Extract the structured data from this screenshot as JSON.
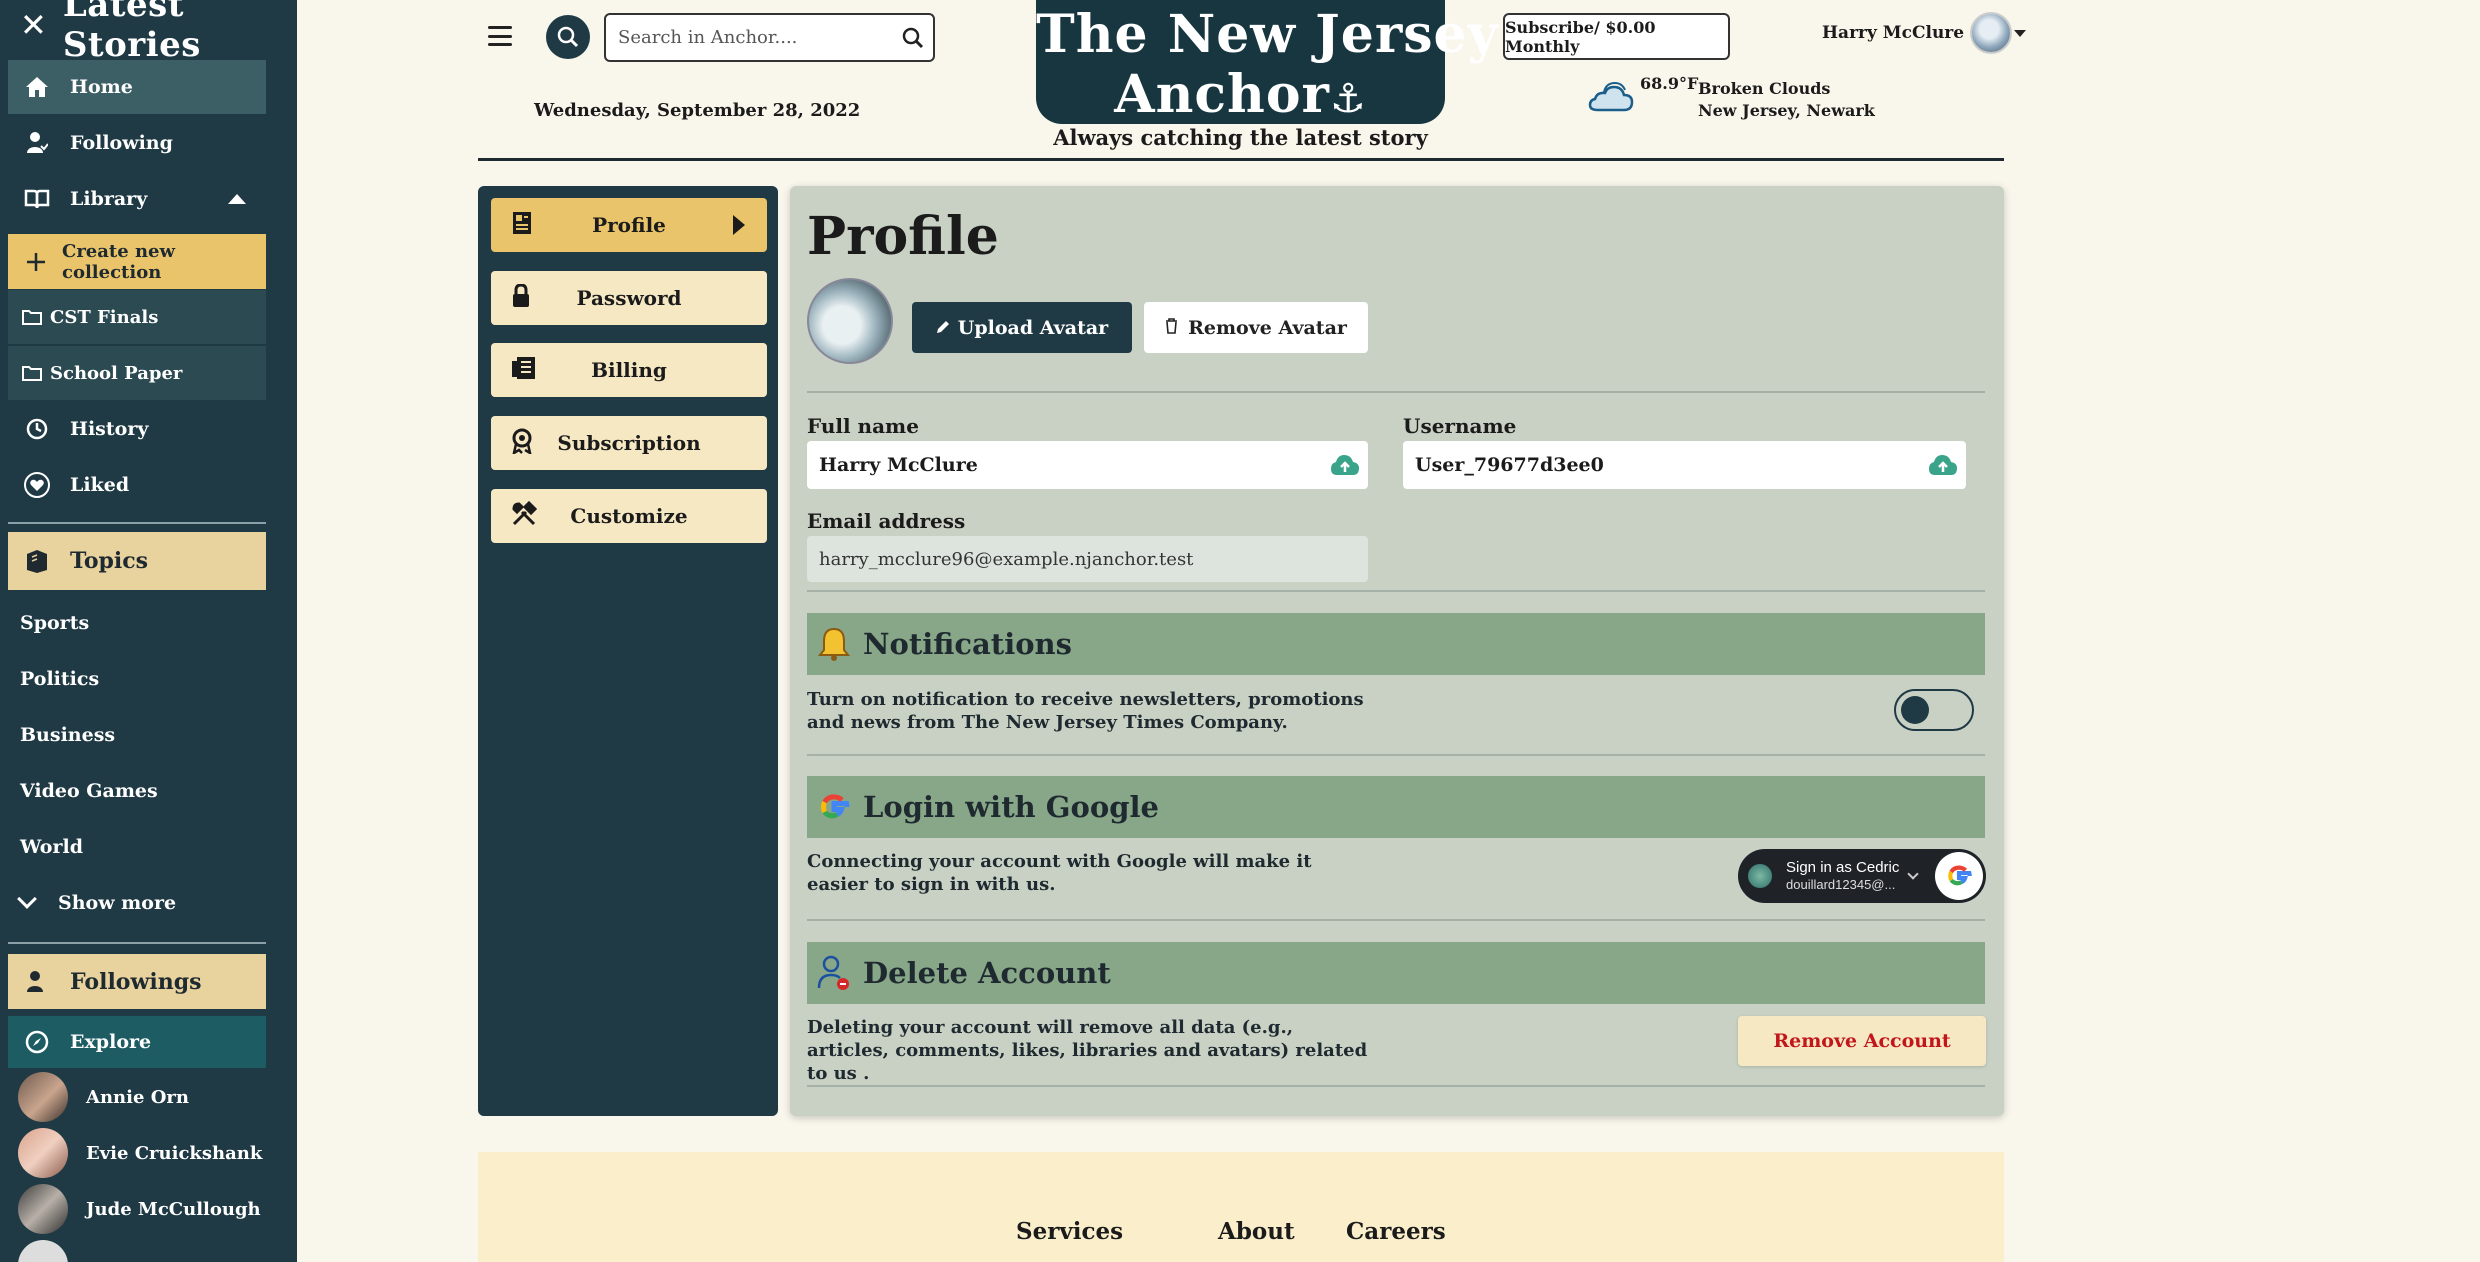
{
  "sidebar": {
    "title": "Latest Stories",
    "items": {
      "home": "Home",
      "following": "Following",
      "library": "Library",
      "create_collection": "Create new collection",
      "collections": [
        "CST Finals",
        "School Paper"
      ],
      "history": "History",
      "liked": "Liked"
    },
    "topics_label": "Topics",
    "topics": [
      "Sports",
      "Politics",
      "Business",
      "Video Games",
      "World"
    ],
    "show_more": "Show more",
    "followings_label": "Followings",
    "explore": "Explore",
    "users": [
      "Annie Orn",
      "Evie Cruickshank",
      "Jude McCullough"
    ]
  },
  "header": {
    "search_placeholder": "Search in Anchor....",
    "date": "Wednesday, September 28, 2022",
    "masthead_line1": "The New Jersey",
    "masthead_line2": "Anchor",
    "tagline": "Always catching the latest story",
    "subscribe": "Subscribe/ $0.00 Monthly",
    "user_name": "Harry McClure",
    "weather": {
      "temp": "68.9°F",
      "condition": "Broken Clouds",
      "location": "New Jersey, Newark"
    }
  },
  "settings_nav": {
    "items": [
      "Profile",
      "Password",
      "Billing",
      "Subscription",
      "Customize"
    ],
    "active": "Profile"
  },
  "profile": {
    "title": "Profile",
    "upload_avatar": "Upload Avatar",
    "remove_avatar": "Remove Avatar",
    "full_name_label": "Full name",
    "full_name": "Harry McClure",
    "username_label": "Username",
    "username": "User_79677d3ee0",
    "email_label": "Email address",
    "email": "harry_mcclure96@example.njanchor.test",
    "notifications": {
      "title": "Notifications",
      "text": "Turn on notification to receive newsletters, promotions and news from The New Jersey Times Company.",
      "enabled": false
    },
    "google": {
      "title": "Login with Google",
      "text": "Connecting your account with Google will make it easier to sign in with us.",
      "sign_in_as": "Sign in as Cedric",
      "account": "douillard12345@..."
    },
    "delete": {
      "title": "Delete Account",
      "text": "Deleting your account will remove all data (e.g., articles, comments, likes, libraries and avatars) related to us .",
      "button": "Remove Account"
    }
  },
  "footer": {
    "links": [
      "Services",
      "About",
      "Careers"
    ]
  },
  "colors": {
    "sidebar": "#1f3a44",
    "accent": "#e9c46a",
    "section_head": "#88a788",
    "danger": "#c2161a"
  }
}
